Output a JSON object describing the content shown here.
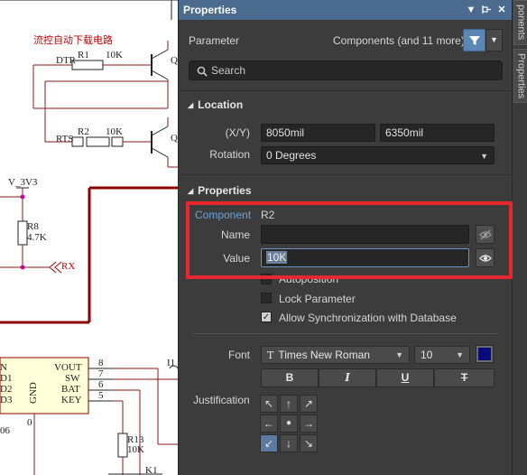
{
  "schematic": {
    "title": "流控自动下载电路",
    "labels": {
      "dtr": "DTR",
      "r1": "R1",
      "r1_val": "10K",
      "rts": "RTS",
      "r2": "R2",
      "r2_val": "10K",
      "q_top": "Q",
      "q_bottom": "Q",
      "v3v3": "V_3V3",
      "r8": "R8",
      "r8_val": "4.7K",
      "rx": "RX",
      "vout": "VOUT",
      "sw": "SW",
      "bat": "BAT",
      "key": "KEY",
      "gnd": "GND",
      "pin8": "8",
      "pin7": "7",
      "pin6": "6",
      "pin5": "5",
      "left1": "N",
      "left2": "D1",
      "left3": "D2",
      "left4": "D3",
      "left5": "06",
      "zero": "0",
      "r13": "R13",
      "r13_val": "10K",
      "k1": "K1",
      "i1": "I1"
    }
  },
  "panel": {
    "title": "Properties",
    "titlebar_icons": [
      "chevron-down-icon",
      "pin-icon",
      "close-icon"
    ],
    "parameter_label": "Parameter",
    "filter_summary": "Components (and 11 more)",
    "search_placeholder": "Search",
    "location": {
      "header": "Location",
      "xy_label": "(X/Y)",
      "x_value": "8050mil",
      "y_value": "6350mil",
      "rotation_label": "Rotation",
      "rotation_value": "0 Degrees"
    },
    "properties": {
      "header": "Properties",
      "component_label": "Component",
      "component_value": "R2",
      "name_label": "Name",
      "name_value": "",
      "value_label": "Value",
      "value_value": "10K",
      "autoposition_label": "Autoposition",
      "lock_parameter_label": "Lock Parameter",
      "allow_sync_label": "Allow Synchronization with Database",
      "allow_sync_checked": true,
      "lock_parameter_checked": false,
      "font_label": "Font",
      "font_name": "Times New Roman",
      "font_size": "10",
      "font_color": "#0a0a80",
      "bold_label": "B",
      "italic_label": "I",
      "underline_label": "U",
      "strike_label": "T",
      "justification_label": "Justification",
      "justification_selected": "bottom-left"
    }
  },
  "side_tabs": [
    "ponents",
    "Properties"
  ],
  "highlight_color": "#e8262d"
}
